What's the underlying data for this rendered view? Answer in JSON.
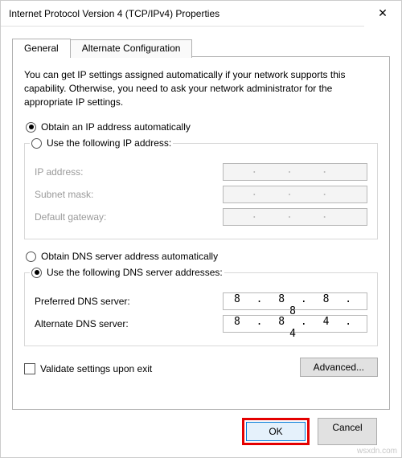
{
  "window": {
    "title": "Internet Protocol Version 4 (TCP/IPv4) Properties",
    "close_glyph": "✕"
  },
  "tabs": {
    "general": "General",
    "alternate": "Alternate Configuration"
  },
  "description": "You can get IP settings assigned automatically if your network supports this capability. Otherwise, you need to ask your network administrator for the appropriate IP settings.",
  "ip": {
    "auto_label": "Obtain an IP address automatically",
    "manual_label": "Use the following IP address:",
    "address_label": "IP address:",
    "subnet_label": "Subnet mask:",
    "gateway_label": "Default gateway:",
    "address_value": ".  .  .",
    "subnet_value": ".  .  .",
    "gateway_value": ".  .  ."
  },
  "dns": {
    "auto_label": "Obtain DNS server address automatically",
    "manual_label": "Use the following DNS server addresses:",
    "preferred_label": "Preferred DNS server:",
    "alternate_label": "Alternate DNS server:",
    "preferred_value": "8 . 8 . 8 . 8",
    "alternate_value": "8 . 8 . 4 . 4"
  },
  "validate_label": "Validate settings upon exit",
  "buttons": {
    "advanced": "Advanced...",
    "ok": "OK",
    "cancel": "Cancel"
  },
  "watermark": "wsxdn.com"
}
